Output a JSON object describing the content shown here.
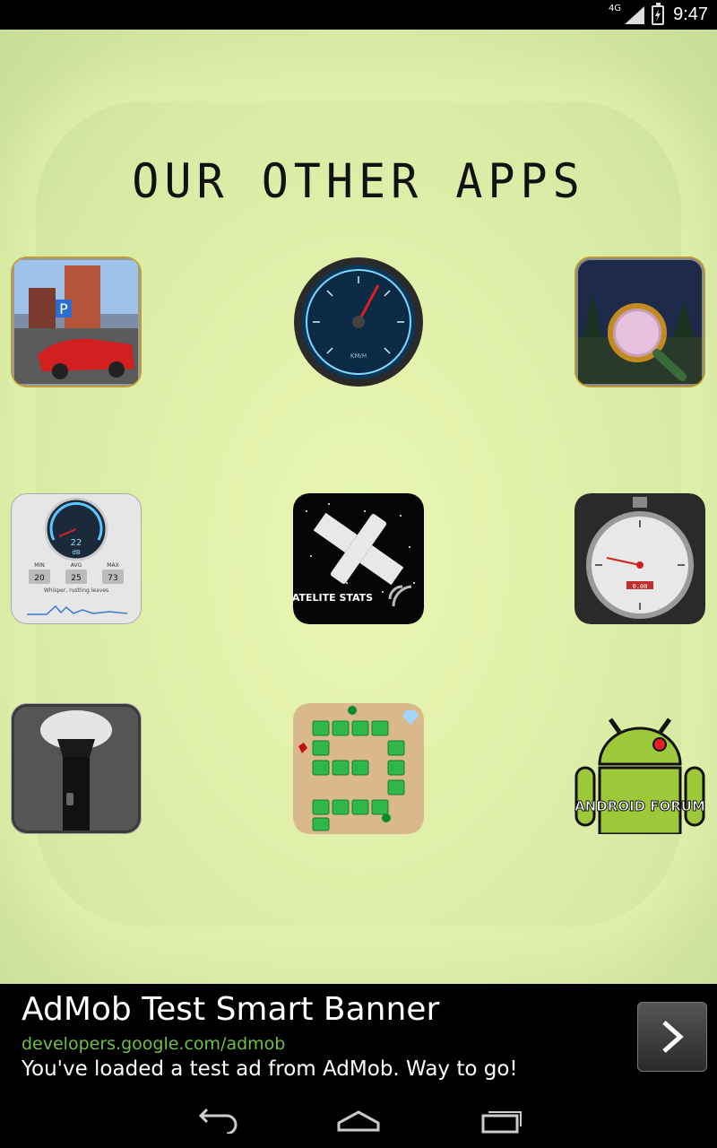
{
  "status_bar": {
    "network": "4G",
    "time": "9:47",
    "icons": [
      "signal-icon",
      "battery-icon"
    ]
  },
  "page": {
    "title": "OUR OTHER APPS"
  },
  "apps": [
    {
      "name": "parking-app-icon",
      "label": "P"
    },
    {
      "name": "speedometer-app-icon",
      "label": "KM/H"
    },
    {
      "name": "hidden-object-app-icon",
      "label": ""
    },
    {
      "name": "sound-meter-app-icon",
      "label": "dB",
      "readout": "22",
      "stats": [
        "MIN",
        "AVG",
        "MAX"
      ],
      "values": [
        "20",
        "25",
        "73"
      ],
      "caption": "Whisper, rustling leaves"
    },
    {
      "name": "satellite-stats-app-icon",
      "label": "SATELITE STATS"
    },
    {
      "name": "stopwatch-app-icon",
      "label": "0.00"
    },
    {
      "name": "flashlight-app-icon",
      "label": ""
    },
    {
      "name": "snake-puzzle-app-icon",
      "label": ""
    },
    {
      "name": "android-forum-app-icon",
      "label": "ANDROID FORUM"
    }
  ],
  "ad": {
    "title": "AdMob Test Smart Banner",
    "url": "developers.google.com/admob",
    "text": "You've loaded a test ad from AdMob. Way to go!"
  },
  "nav": {
    "icons": [
      "back-icon",
      "home-icon",
      "recent-apps-icon"
    ]
  },
  "colors": {
    "background": "#e2f1aa",
    "ad_url": "#6fbf4b"
  }
}
